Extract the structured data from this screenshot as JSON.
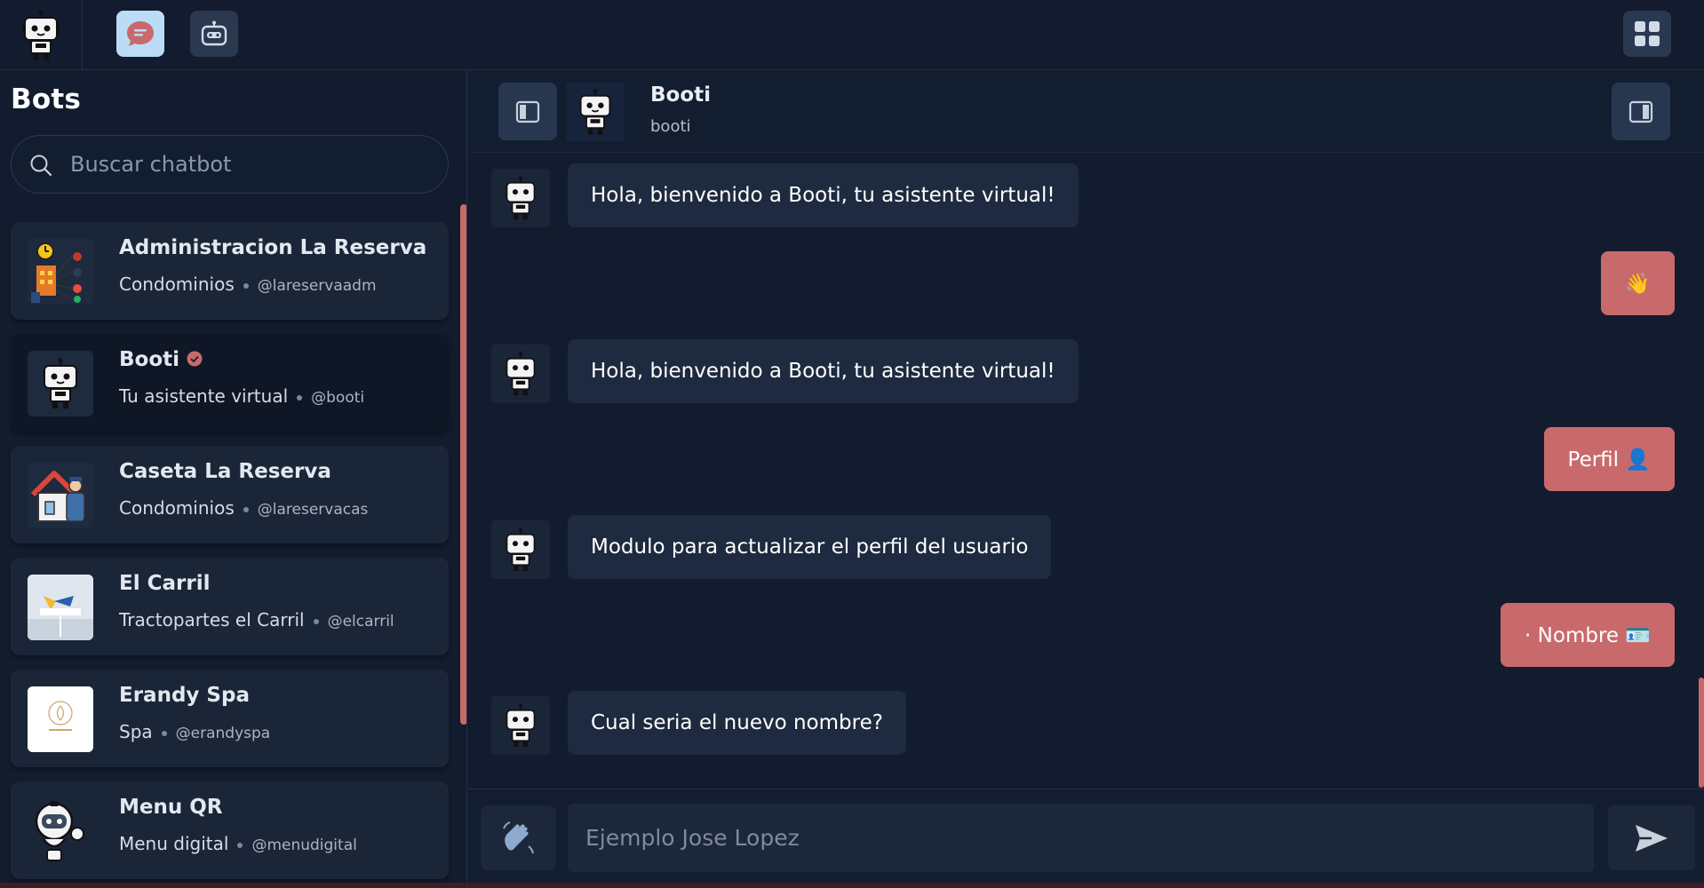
{
  "sidebar": {
    "title": "Bots",
    "search_placeholder": "Buscar chatbot",
    "bots": [
      {
        "name": "Administracion La Reserva",
        "category": "Condominios",
        "handle": "@lareservaadm"
      },
      {
        "name": "Booti",
        "category": "Tu asistente virtual",
        "handle": "@booti",
        "verified": true
      },
      {
        "name": "Caseta La Reserva",
        "category": "Condominios",
        "handle": "@lareservacas"
      },
      {
        "name": "El Carril",
        "category": "Tractopartes el Carril",
        "handle": "@elcarril"
      },
      {
        "name": "Erandy Spa",
        "category": "Spa",
        "handle": "@erandyspa"
      },
      {
        "name": "Menu QR",
        "category": "Menu digital",
        "handle": "@menudigital"
      }
    ]
  },
  "chat": {
    "bot_name": "Booti",
    "bot_handle": "booti",
    "messages": [
      {
        "from": "bot",
        "text": "Hola, bienvenido a Booti, tu asistente virtual!"
      },
      {
        "from": "user",
        "text": "👋"
      },
      {
        "from": "bot",
        "text": "Hola, bienvenido a Booti, tu asistente virtual!"
      },
      {
        "from": "user",
        "text": "Perfil 👤"
      },
      {
        "from": "bot",
        "text": "Modulo para actualizar el perfil del usuario"
      },
      {
        "from": "user",
        "text": "· Nombre 🪪"
      },
      {
        "from": "bot",
        "text": "Cual seria el nuevo nombre?"
      }
    ],
    "input_placeholder": "Ejemplo Jose Lopez"
  },
  "colors": {
    "background": "#121c2e",
    "accent": "#c86a6c",
    "chat_tab_active": "#bcdcf6"
  }
}
